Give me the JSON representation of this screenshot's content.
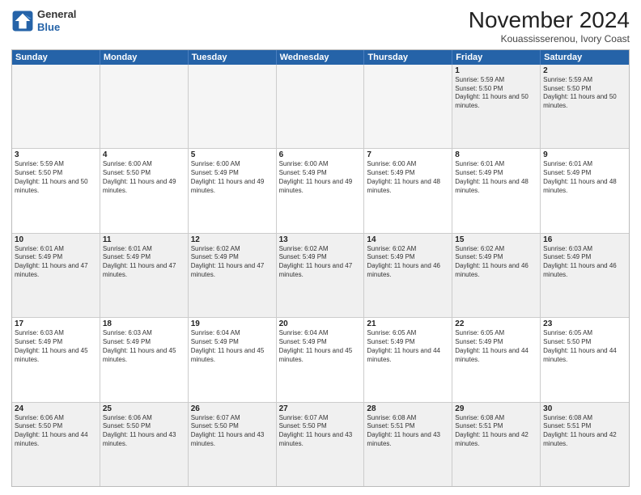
{
  "logo": {
    "general": "General",
    "blue": "Blue"
  },
  "title": "November 2024",
  "location": "Kouassisserenou, Ivory Coast",
  "days": [
    "Sunday",
    "Monday",
    "Tuesday",
    "Wednesday",
    "Thursday",
    "Friday",
    "Saturday"
  ],
  "weeks": [
    [
      {
        "day": "",
        "info": "",
        "empty": true
      },
      {
        "day": "",
        "info": "",
        "empty": true
      },
      {
        "day": "",
        "info": "",
        "empty": true
      },
      {
        "day": "",
        "info": "",
        "empty": true
      },
      {
        "day": "",
        "info": "",
        "empty": true
      },
      {
        "day": "1",
        "sunrise": "Sunrise: 5:59 AM",
        "sunset": "Sunset: 5:50 PM",
        "daylight": "Daylight: 11 hours and 50 minutes."
      },
      {
        "day": "2",
        "sunrise": "Sunrise: 5:59 AM",
        "sunset": "Sunset: 5:50 PM",
        "daylight": "Daylight: 11 hours and 50 minutes."
      }
    ],
    [
      {
        "day": "3",
        "sunrise": "Sunrise: 5:59 AM",
        "sunset": "Sunset: 5:50 PM",
        "daylight": "Daylight: 11 hours and 50 minutes."
      },
      {
        "day": "4",
        "sunrise": "Sunrise: 6:00 AM",
        "sunset": "Sunset: 5:50 PM",
        "daylight": "Daylight: 11 hours and 49 minutes."
      },
      {
        "day": "5",
        "sunrise": "Sunrise: 6:00 AM",
        "sunset": "Sunset: 5:49 PM",
        "daylight": "Daylight: 11 hours and 49 minutes."
      },
      {
        "day": "6",
        "sunrise": "Sunrise: 6:00 AM",
        "sunset": "Sunset: 5:49 PM",
        "daylight": "Daylight: 11 hours and 49 minutes."
      },
      {
        "day": "7",
        "sunrise": "Sunrise: 6:00 AM",
        "sunset": "Sunset: 5:49 PM",
        "daylight": "Daylight: 11 hours and 48 minutes."
      },
      {
        "day": "8",
        "sunrise": "Sunrise: 6:01 AM",
        "sunset": "Sunset: 5:49 PM",
        "daylight": "Daylight: 11 hours and 48 minutes."
      },
      {
        "day": "9",
        "sunrise": "Sunrise: 6:01 AM",
        "sunset": "Sunset: 5:49 PM",
        "daylight": "Daylight: 11 hours and 48 minutes."
      }
    ],
    [
      {
        "day": "10",
        "sunrise": "Sunrise: 6:01 AM",
        "sunset": "Sunset: 5:49 PM",
        "daylight": "Daylight: 11 hours and 47 minutes."
      },
      {
        "day": "11",
        "sunrise": "Sunrise: 6:01 AM",
        "sunset": "Sunset: 5:49 PM",
        "daylight": "Daylight: 11 hours and 47 minutes."
      },
      {
        "day": "12",
        "sunrise": "Sunrise: 6:02 AM",
        "sunset": "Sunset: 5:49 PM",
        "daylight": "Daylight: 11 hours and 47 minutes."
      },
      {
        "day": "13",
        "sunrise": "Sunrise: 6:02 AM",
        "sunset": "Sunset: 5:49 PM",
        "daylight": "Daylight: 11 hours and 47 minutes."
      },
      {
        "day": "14",
        "sunrise": "Sunrise: 6:02 AM",
        "sunset": "Sunset: 5:49 PM",
        "daylight": "Daylight: 11 hours and 46 minutes."
      },
      {
        "day": "15",
        "sunrise": "Sunrise: 6:02 AM",
        "sunset": "Sunset: 5:49 PM",
        "daylight": "Daylight: 11 hours and 46 minutes."
      },
      {
        "day": "16",
        "sunrise": "Sunrise: 6:03 AM",
        "sunset": "Sunset: 5:49 PM",
        "daylight": "Daylight: 11 hours and 46 minutes."
      }
    ],
    [
      {
        "day": "17",
        "sunrise": "Sunrise: 6:03 AM",
        "sunset": "Sunset: 5:49 PM",
        "daylight": "Daylight: 11 hours and 45 minutes."
      },
      {
        "day": "18",
        "sunrise": "Sunrise: 6:03 AM",
        "sunset": "Sunset: 5:49 PM",
        "daylight": "Daylight: 11 hours and 45 minutes."
      },
      {
        "day": "19",
        "sunrise": "Sunrise: 6:04 AM",
        "sunset": "Sunset: 5:49 PM",
        "daylight": "Daylight: 11 hours and 45 minutes."
      },
      {
        "day": "20",
        "sunrise": "Sunrise: 6:04 AM",
        "sunset": "Sunset: 5:49 PM",
        "daylight": "Daylight: 11 hours and 45 minutes."
      },
      {
        "day": "21",
        "sunrise": "Sunrise: 6:05 AM",
        "sunset": "Sunset: 5:49 PM",
        "daylight": "Daylight: 11 hours and 44 minutes."
      },
      {
        "day": "22",
        "sunrise": "Sunrise: 6:05 AM",
        "sunset": "Sunset: 5:49 PM",
        "daylight": "Daylight: 11 hours and 44 minutes."
      },
      {
        "day": "23",
        "sunrise": "Sunrise: 6:05 AM",
        "sunset": "Sunset: 5:50 PM",
        "daylight": "Daylight: 11 hours and 44 minutes."
      }
    ],
    [
      {
        "day": "24",
        "sunrise": "Sunrise: 6:06 AM",
        "sunset": "Sunset: 5:50 PM",
        "daylight": "Daylight: 11 hours and 44 minutes."
      },
      {
        "day": "25",
        "sunrise": "Sunrise: 6:06 AM",
        "sunset": "Sunset: 5:50 PM",
        "daylight": "Daylight: 11 hours and 43 minutes."
      },
      {
        "day": "26",
        "sunrise": "Sunrise: 6:07 AM",
        "sunset": "Sunset: 5:50 PM",
        "daylight": "Daylight: 11 hours and 43 minutes."
      },
      {
        "day": "27",
        "sunrise": "Sunrise: 6:07 AM",
        "sunset": "Sunset: 5:50 PM",
        "daylight": "Daylight: 11 hours and 43 minutes."
      },
      {
        "day": "28",
        "sunrise": "Sunrise: 6:08 AM",
        "sunset": "Sunset: 5:51 PM",
        "daylight": "Daylight: 11 hours and 43 minutes."
      },
      {
        "day": "29",
        "sunrise": "Sunrise: 6:08 AM",
        "sunset": "Sunset: 5:51 PM",
        "daylight": "Daylight: 11 hours and 42 minutes."
      },
      {
        "day": "30",
        "sunrise": "Sunrise: 6:08 AM",
        "sunset": "Sunset: 5:51 PM",
        "daylight": "Daylight: 11 hours and 42 minutes."
      }
    ]
  ]
}
